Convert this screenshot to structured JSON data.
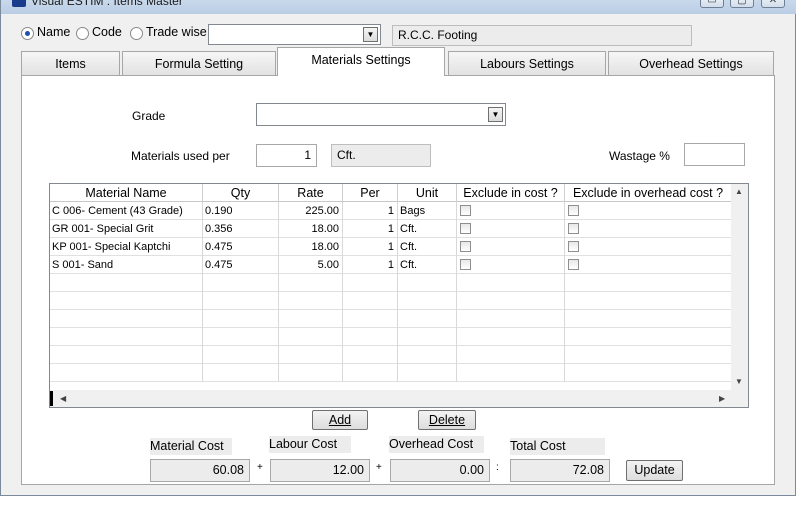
{
  "window": {
    "title": "Visual ESTIM : Items Master",
    "minimize": "▭",
    "maximize": "▢",
    "close": "✕"
  },
  "filter": {
    "options": [
      "Name",
      "Code",
      "Trade wise"
    ],
    "selected": "Name",
    "trade_combo_value": "",
    "item_name": "R.C.C. Footing"
  },
  "tabs": [
    "Items",
    "Formula Setting",
    "Materials Settings",
    "Labours Settings",
    "Overhead Settings"
  ],
  "active_tab": "Materials Settings",
  "materials": {
    "grade_label": "Grade",
    "grade_value": "",
    "used_per_label": "Materials used per",
    "used_per_value": "1",
    "used_per_unit": "Cft.",
    "wastage_label": "Wastage %",
    "wastage_value": ""
  },
  "grid": {
    "columns": [
      "Material Name",
      "Qty",
      "Rate",
      "Per",
      "Unit",
      "Exclude in cost ?",
      "Exclude in overhead cost ?"
    ],
    "rows": [
      {
        "name": "C 006- Cement (43 Grade)",
        "qty": "0.190",
        "rate": "225.00",
        "per": "1",
        "unit": "Bags",
        "excl_cost": false,
        "excl_overhead": false
      },
      {
        "name": "GR 001- Special  Grit",
        "qty": "0.356",
        "rate": "18.00",
        "per": "1",
        "unit": "Cft.",
        "excl_cost": false,
        "excl_overhead": false
      },
      {
        "name": "KP 001- Special Kaptchi",
        "qty": "0.475",
        "rate": "18.00",
        "per": "1",
        "unit": "Cft.",
        "excl_cost": false,
        "excl_overhead": false
      },
      {
        "name": "S 001- Sand",
        "qty": "0.475",
        "rate": "5.00",
        "per": "1",
        "unit": "Cft.",
        "excl_cost": false,
        "excl_overhead": false
      }
    ],
    "empty_rows": 6
  },
  "actions": {
    "add": "Add",
    "delete": "Delete",
    "update": "Update"
  },
  "costs": {
    "material_label": "Material Cost",
    "material_value": "60.08",
    "labour_label": "Labour Cost",
    "labour_value": "12.00",
    "overhead_label": "Overhead Cost",
    "overhead_value": "0.00",
    "total_label": "Total Cost",
    "total_value": "72.08",
    "plus": "+",
    "colon": ":"
  },
  "icons": {
    "app": "app-icon",
    "combo_arrow": "▼",
    "scroll_up": "▲",
    "scroll_down": "▼",
    "scroll_left": "◀",
    "scroll_right": "▶"
  }
}
